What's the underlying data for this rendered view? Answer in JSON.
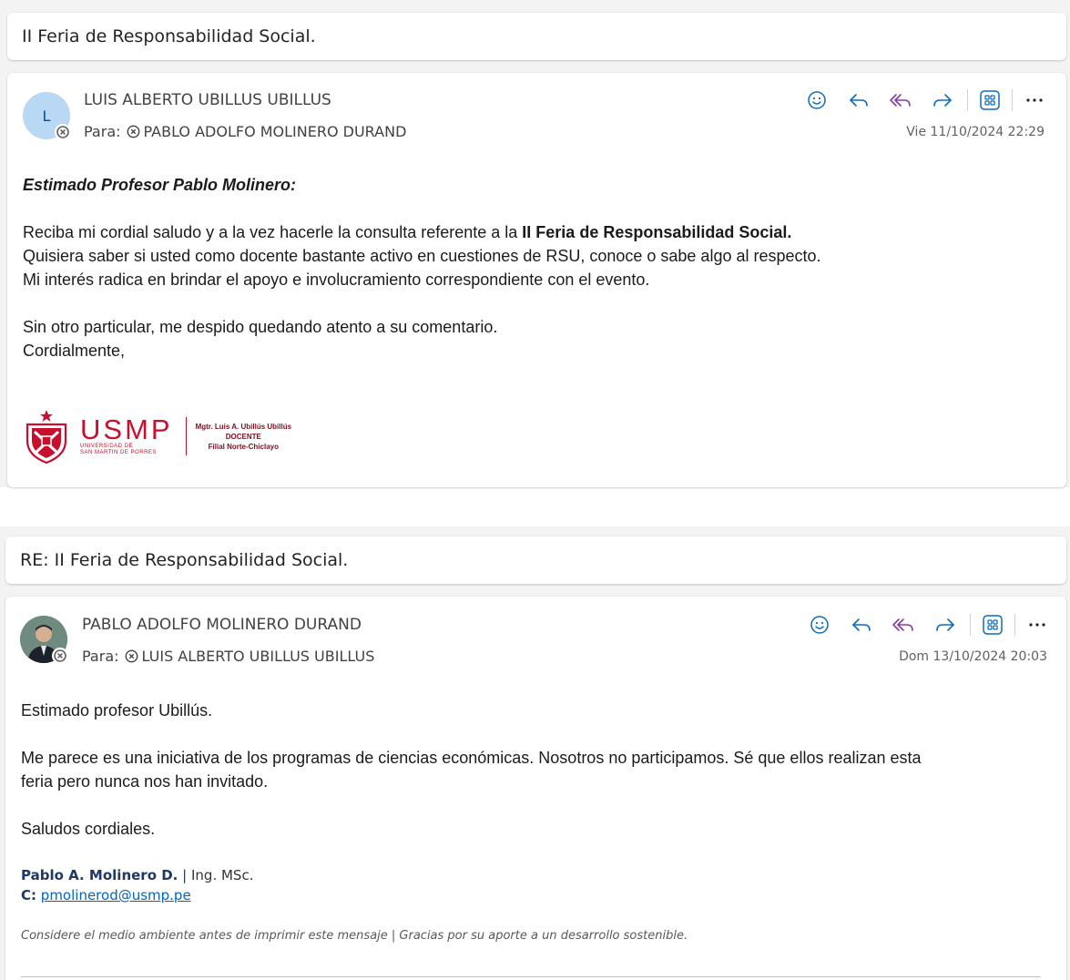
{
  "thread1": {
    "subject": "II Feria de Responsabilidad Social.",
    "message": {
      "avatar_initial": "L",
      "sender": "LUIS ALBERTO UBILLUS UBILLUS",
      "to_label": "Para:",
      "recipient": "PABLO ADOLFO MOLINERO DURAND",
      "date": "Vie 11/10/2024 22:29",
      "greeting": "Estimado Profesor Pablo Molinero:",
      "para1_before": "Reciba mi cordial saludo y a la vez hacerle la consulta referente a la ",
      "para1_bold": "II Feria de Responsabilidad Social.",
      "para2": "Quisiera saber si usted como docente bastante activo en cuestiones de RSU, conoce o sabe algo al respecto.",
      "para3": "Mi interés radica en brindar el apoyo e involucramiento correspondiente con el evento.",
      "closing1": "Sin otro particular, me despido quedando atento a su comentario.",
      "closing2": "Cordialmente,",
      "signature": {
        "logo_word": "USMP",
        "logo_sub1": "UNIVERSIDAD DE",
        "logo_sub2": "SAN MARTIN DE PORRES",
        "line1": "Mgtr. Luis A. Ubillús Ubillús",
        "line2": "DOCENTE",
        "line3": "Filial Norte-Chiclayo"
      }
    }
  },
  "thread2": {
    "subject": "RE: II Feria de Responsabilidad Social.",
    "message": {
      "sender": "PABLO ADOLFO MOLINERO DURAND",
      "to_label": "Para:",
      "recipient": "LUIS ALBERTO UBILLUS UBILLUS",
      "date": "Dom 13/10/2024 20:03",
      "greeting": "Estimado profesor Ubillús.",
      "para1_line1": "Me parece es una iniciativa de los programas de ciencias económicas. Nosotros no participamos. Sé que ellos realizan esta",
      "para1_line2": "feria pero nunca nos han invitado.",
      "closing": "Saludos cordiales.",
      "signature": {
        "name": "Pablo A. Molinero D.",
        "separator": "|",
        "title": "Ing. MSc.",
        "contact_label": "C:",
        "email": "pmolinerod@usmp.pe"
      },
      "footer": "Considere el medio ambiente antes de imprimir este mensaje | Gracias por su aporte a un desarrollo sostenible."
    }
  },
  "colors": {
    "action_blue": "#0f6cbd",
    "apps_purple": "#8a3ba5",
    "brand_red": "#c8102e"
  }
}
